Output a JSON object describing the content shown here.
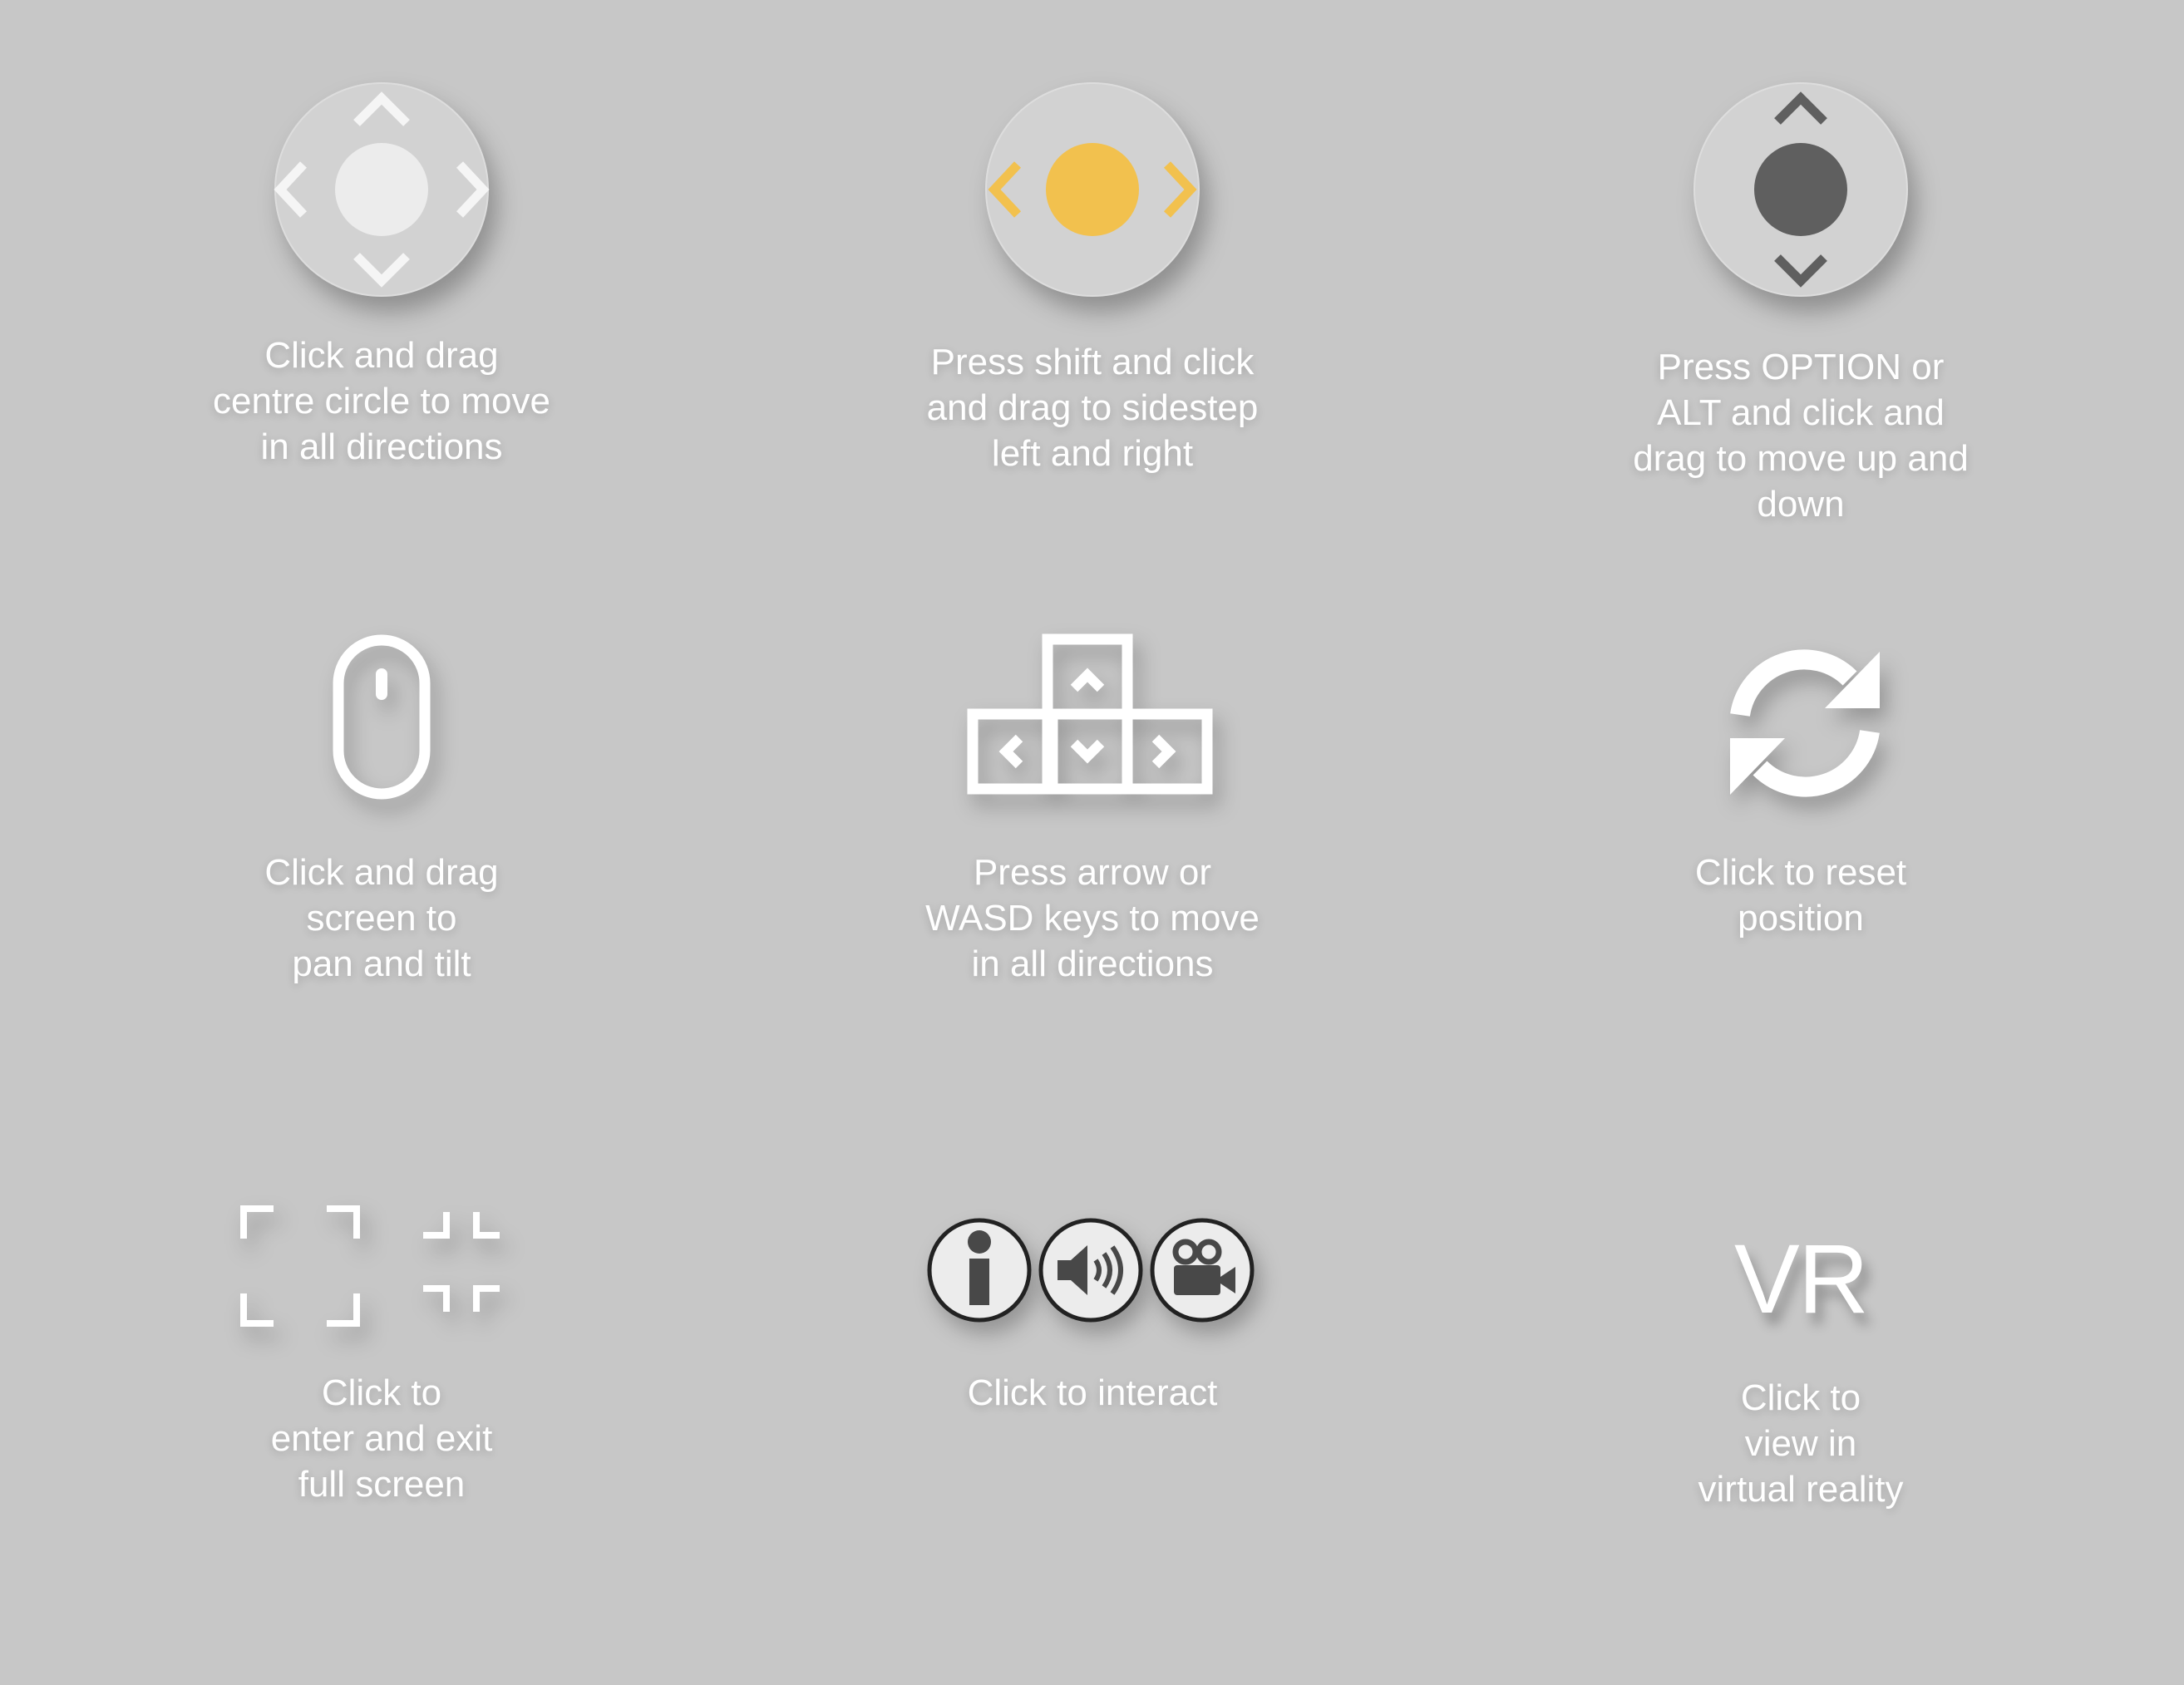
{
  "colors": {
    "background": "#c7c7c7",
    "joystick_disc": "#d2d2d2",
    "white": "#ffffff",
    "accent_yellow": "#f2c14e",
    "dark_gray": "#5f5f5f",
    "icon_border": "#222222",
    "icon_fill": "#ececec"
  },
  "instructions": [
    {
      "id": "move-all",
      "icon": "joystick-all-directions-icon",
      "lines": [
        "Click and drag",
        "centre circle to move",
        "in all directions"
      ]
    },
    {
      "id": "sidestep",
      "icon": "joystick-sidestep-icon",
      "lines": [
        "Press shift and click",
        "and drag to sidestep",
        "left and right"
      ]
    },
    {
      "id": "up-down",
      "icon": "joystick-up-down-icon",
      "lines": [
        "Press OPTION or",
        "ALT and click and",
        "drag to move up and",
        "down"
      ]
    },
    {
      "id": "pan-tilt",
      "icon": "mouse-icon",
      "lines": [
        "Click and drag",
        "screen to",
        "pan and tilt"
      ]
    },
    {
      "id": "keys",
      "icon": "arrow-keys-icon",
      "lines": [
        "Press arrow or",
        "WASD keys to move",
        "in all directions"
      ]
    },
    {
      "id": "reset",
      "icon": "reset-icon",
      "lines": [
        "Click to reset",
        "position"
      ]
    },
    {
      "id": "fullscreen",
      "icon": "fullscreen-icon",
      "lines": [
        "Click to",
        "enter and exit",
        "full screen"
      ]
    },
    {
      "id": "interact",
      "icon": "interact-icons",
      "lines": [
        "Click to interact"
      ]
    },
    {
      "id": "vr",
      "icon": "vr-icon",
      "vr_label": "VR",
      "lines": [
        "Click to",
        "view in",
        "virtual reality"
      ]
    }
  ]
}
